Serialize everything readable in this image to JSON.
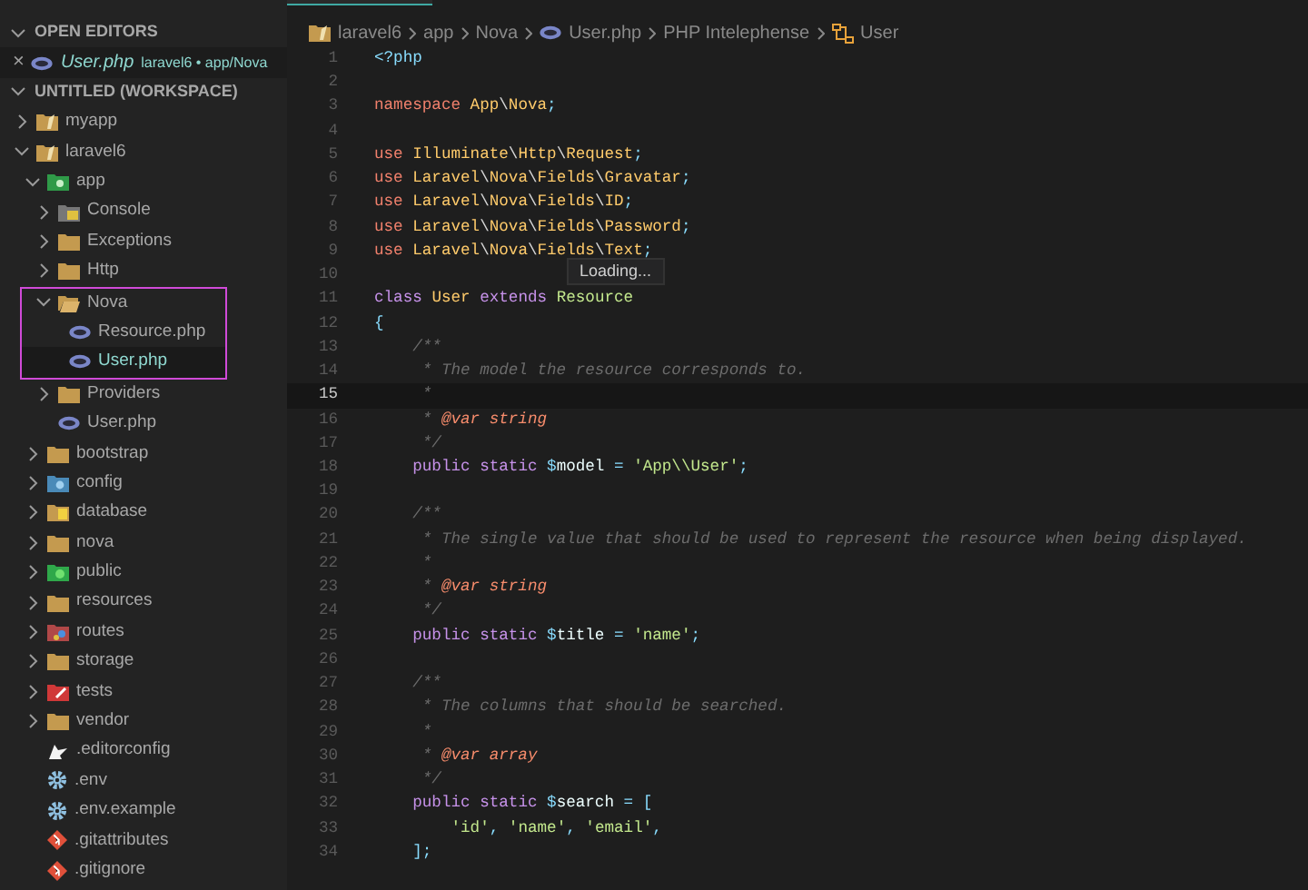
{
  "open_editors": {
    "header": "OPEN EDITORS",
    "items": [
      {
        "close": "×",
        "name": "User.php",
        "description": "laravel6 • app/Nova",
        "kind": "php"
      }
    ]
  },
  "workspace": {
    "header": "UNTITLED (WORKSPACE)",
    "tree": [
      {
        "name": "myapp",
        "kind": "folder-root",
        "expanded": false,
        "selected": false
      },
      {
        "name": "laravel6",
        "kind": "folder-root",
        "expanded": true,
        "selected": false,
        "children": [
          {
            "name": "app",
            "kind": "folder-app",
            "expanded": true,
            "selected": false,
            "children": [
              {
                "name": "Console",
                "kind": "folder-console",
                "expanded": false,
                "selected": false
              },
              {
                "name": "Exceptions",
                "kind": "folder",
                "expanded": false,
                "selected": false
              },
              {
                "name": "Http",
                "kind": "folder",
                "expanded": false,
                "selected": false
              },
              {
                "name": "Nova",
                "kind": "folder-open",
                "expanded": true,
                "selected": false,
                "highlighted": true,
                "children": [
                  {
                    "name": "Resource.php",
                    "kind": "php",
                    "selected": false
                  },
                  {
                    "name": "User.php",
                    "kind": "php",
                    "selected": true
                  }
                ]
              },
              {
                "name": "Providers",
                "kind": "folder",
                "expanded": false,
                "selected": false
              },
              {
                "name": "User.php",
                "kind": "php",
                "selected": false
              }
            ]
          },
          {
            "name": "bootstrap",
            "kind": "folder",
            "expanded": false,
            "selected": false
          },
          {
            "name": "config",
            "kind": "folder-config",
            "expanded": false,
            "selected": false
          },
          {
            "name": "database",
            "kind": "folder-database",
            "expanded": false,
            "selected": false
          },
          {
            "name": "nova",
            "kind": "folder",
            "expanded": false,
            "selected": false
          },
          {
            "name": "public",
            "kind": "folder-public",
            "expanded": false,
            "selected": false
          },
          {
            "name": "resources",
            "kind": "folder",
            "expanded": false,
            "selected": false
          },
          {
            "name": "routes",
            "kind": "folder-routes",
            "expanded": false,
            "selected": false
          },
          {
            "name": "storage",
            "kind": "folder",
            "expanded": false,
            "selected": false
          },
          {
            "name": "tests",
            "kind": "folder-test",
            "expanded": false,
            "selected": false
          },
          {
            "name": "vendor",
            "kind": "folder",
            "expanded": false,
            "selected": false
          },
          {
            "name": ".editorconfig",
            "kind": "editorconfig",
            "selected": false
          },
          {
            "name": ".env",
            "kind": "gear",
            "selected": false
          },
          {
            "name": ".env.example",
            "kind": "gear",
            "selected": false
          },
          {
            "name": ".gitattributes",
            "kind": "git",
            "selected": false
          },
          {
            "name": ".gitignore",
            "kind": "git",
            "selected": false
          }
        ]
      }
    ]
  },
  "breadcrumbs": [
    {
      "label": "laravel6",
      "kind": "folder-root"
    },
    {
      "label": "app"
    },
    {
      "label": "Nova"
    },
    {
      "label": "User.php",
      "kind": "php"
    },
    {
      "label": "PHP Intelephense"
    },
    {
      "label": "User",
      "kind": "class"
    }
  ],
  "tooltip": "Loading...",
  "code_lines": [
    {
      "number": "1",
      "current": false,
      "tokens": [
        {
          "kind": "tag",
          "text": "<?php"
        }
      ]
    },
    {
      "number": "2",
      "current": false
    },
    {
      "number": "3",
      "current": false,
      "tokens": [
        {
          "kind": "kw",
          "text": "namespace "
        },
        {
          "kind": "ns",
          "text": "App"
        },
        {
          "kind": "sep",
          "text": "\\"
        },
        {
          "kind": "ns",
          "text": "Nova"
        },
        {
          "kind": "p",
          "text": ";"
        }
      ]
    },
    {
      "number": "4",
      "current": false
    },
    {
      "number": "5",
      "current": false,
      "tokens": [
        {
          "kind": "kw",
          "text": "use "
        },
        {
          "kind": "ns",
          "text": "Illuminate"
        },
        {
          "kind": "sep",
          "text": "\\"
        },
        {
          "kind": "ns",
          "text": "Http"
        },
        {
          "kind": "sep",
          "text": "\\"
        },
        {
          "kind": "ns",
          "text": "Request"
        },
        {
          "kind": "p",
          "text": ";"
        }
      ]
    },
    {
      "number": "6",
      "current": false,
      "tokens": [
        {
          "kind": "kw",
          "text": "use "
        },
        {
          "kind": "ns",
          "text": "Laravel"
        },
        {
          "kind": "sep",
          "text": "\\"
        },
        {
          "kind": "ns",
          "text": "Nova"
        },
        {
          "kind": "sep",
          "text": "\\"
        },
        {
          "kind": "ns",
          "text": "Fields"
        },
        {
          "kind": "sep",
          "text": "\\"
        },
        {
          "kind": "ns",
          "text": "Gravatar"
        },
        {
          "kind": "p",
          "text": ";"
        }
      ]
    },
    {
      "number": "7",
      "current": false,
      "tokens": [
        {
          "kind": "kw",
          "text": "use "
        },
        {
          "kind": "ns",
          "text": "Laravel"
        },
        {
          "kind": "sep",
          "text": "\\"
        },
        {
          "kind": "ns",
          "text": "Nova"
        },
        {
          "kind": "sep",
          "text": "\\"
        },
        {
          "kind": "ns",
          "text": "Fields"
        },
        {
          "kind": "sep",
          "text": "\\"
        },
        {
          "kind": "ns",
          "text": "ID"
        },
        {
          "kind": "p",
          "text": ";"
        }
      ]
    },
    {
      "number": "8",
      "current": false,
      "tokens": [
        {
          "kind": "kw",
          "text": "use "
        },
        {
          "kind": "ns",
          "text": "Laravel"
        },
        {
          "kind": "sep",
          "text": "\\"
        },
        {
          "kind": "ns",
          "text": "Nova"
        },
        {
          "kind": "sep",
          "text": "\\"
        },
        {
          "kind": "ns",
          "text": "Fields"
        },
        {
          "kind": "sep",
          "text": "\\"
        },
        {
          "kind": "ns",
          "text": "Password"
        },
        {
          "kind": "p",
          "text": ";"
        }
      ]
    },
    {
      "number": "9",
      "current": false,
      "tokens": [
        {
          "kind": "kw",
          "text": "use "
        },
        {
          "kind": "ns",
          "text": "Laravel"
        },
        {
          "kind": "sep",
          "text": "\\"
        },
        {
          "kind": "ns",
          "text": "Nova"
        },
        {
          "kind": "sep",
          "text": "\\"
        },
        {
          "kind": "ns",
          "text": "Fields"
        },
        {
          "kind": "sep",
          "text": "\\"
        },
        {
          "kind": "ns",
          "text": "Text"
        },
        {
          "kind": "p",
          "text": ";"
        }
      ]
    },
    {
      "number": "10",
      "current": false
    },
    {
      "number": "11",
      "current": false,
      "tokens": [
        {
          "kind": "mod",
          "text": "class "
        },
        {
          "kind": "ns",
          "text": "User "
        },
        {
          "kind": "mod",
          "text": "extends "
        },
        {
          "kind": "cls",
          "text": "Resource"
        }
      ]
    },
    {
      "number": "12",
      "current": false,
      "tokens": [
        {
          "kind": "p",
          "text": "{"
        }
      ]
    },
    {
      "number": "13",
      "current": false,
      "tokens": [
        {
          "kind": "cm",
          "text": "    /**"
        }
      ]
    },
    {
      "number": "14",
      "current": false,
      "tokens": [
        {
          "kind": "cm",
          "text": "     * The model the resource corresponds to."
        }
      ]
    },
    {
      "number": "15",
      "current": true,
      "tokens": [
        {
          "kind": "cm",
          "text": "     *"
        }
      ]
    },
    {
      "number": "16",
      "current": false,
      "tokens": [
        {
          "kind": "cm",
          "text": "     * "
        },
        {
          "kind": "doc",
          "text": "@var string"
        }
      ]
    },
    {
      "number": "17",
      "current": false,
      "tokens": [
        {
          "kind": "cm",
          "text": "     */"
        }
      ]
    },
    {
      "number": "18",
      "current": false,
      "tokens": [
        {
          "kind": "mod",
          "text": "    public "
        },
        {
          "kind": "mod",
          "text": "static "
        },
        {
          "kind": "p",
          "text": "$"
        },
        {
          "kind": "pl",
          "text": "model "
        },
        {
          "kind": "p",
          "text": "= "
        },
        {
          "kind": "str",
          "text": "'App\\\\User'"
        },
        {
          "kind": "p",
          "text": ";"
        }
      ]
    },
    {
      "number": "19",
      "current": false
    },
    {
      "number": "20",
      "current": false,
      "tokens": [
        {
          "kind": "cm",
          "text": "    /**"
        }
      ]
    },
    {
      "number": "21",
      "current": false,
      "tokens": [
        {
          "kind": "cm",
          "text": "     * The single value that should be used to represent the resource when being displayed."
        }
      ]
    },
    {
      "number": "22",
      "current": false,
      "tokens": [
        {
          "kind": "cm",
          "text": "     *"
        }
      ]
    },
    {
      "number": "23",
      "current": false,
      "tokens": [
        {
          "kind": "cm",
          "text": "     * "
        },
        {
          "kind": "doc",
          "text": "@var string"
        }
      ]
    },
    {
      "number": "24",
      "current": false,
      "tokens": [
        {
          "kind": "cm",
          "text": "     */"
        }
      ]
    },
    {
      "number": "25",
      "current": false,
      "tokens": [
        {
          "kind": "mod",
          "text": "    public "
        },
        {
          "kind": "mod",
          "text": "static "
        },
        {
          "kind": "p",
          "text": "$"
        },
        {
          "kind": "pl",
          "text": "title "
        },
        {
          "kind": "p",
          "text": "= "
        },
        {
          "kind": "str",
          "text": "'name'"
        },
        {
          "kind": "p",
          "text": ";"
        }
      ]
    },
    {
      "number": "26",
      "current": false
    },
    {
      "number": "27",
      "current": false,
      "tokens": [
        {
          "kind": "cm",
          "text": "    /**"
        }
      ]
    },
    {
      "number": "28",
      "current": false,
      "tokens": [
        {
          "kind": "cm",
          "text": "     * The columns that should be searched."
        }
      ]
    },
    {
      "number": "29",
      "current": false,
      "tokens": [
        {
          "kind": "cm",
          "text": "     *"
        }
      ]
    },
    {
      "number": "30",
      "current": false,
      "tokens": [
        {
          "kind": "cm",
          "text": "     * "
        },
        {
          "kind": "doc",
          "text": "@var array"
        }
      ]
    },
    {
      "number": "31",
      "current": false,
      "tokens": [
        {
          "kind": "cm",
          "text": "     */"
        }
      ]
    },
    {
      "number": "32",
      "current": false,
      "tokens": [
        {
          "kind": "mod",
          "text": "    public "
        },
        {
          "kind": "mod",
          "text": "static "
        },
        {
          "kind": "p",
          "text": "$"
        },
        {
          "kind": "pl",
          "text": "search "
        },
        {
          "kind": "p",
          "text": "= ["
        }
      ]
    },
    {
      "number": "33",
      "current": false,
      "tokens": [
        {
          "kind": "str",
          "text": "        'id'"
        },
        {
          "kind": "p",
          "text": ", "
        },
        {
          "kind": "str",
          "text": "'name'"
        },
        {
          "kind": "p",
          "text": ", "
        },
        {
          "kind": "str",
          "text": "'email'"
        },
        {
          "kind": "p",
          "text": ","
        }
      ]
    },
    {
      "number": "34",
      "current": false,
      "tokens": [
        {
          "kind": "p",
          "text": "    ];"
        }
      ]
    }
  ]
}
